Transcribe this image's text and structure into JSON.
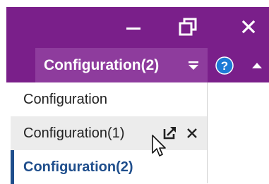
{
  "window_controls": {
    "minimize": "minimize-icon",
    "restore": "restore-icon",
    "close": "close-icon"
  },
  "header": {
    "active_tab_label": "Configuration(2)",
    "dropdown_icon": "dropdown-arrow-icon",
    "help_icon": "help-icon",
    "collapse_icon": "collapse-icon"
  },
  "menu": {
    "items": [
      {
        "label": "Configuration"
      },
      {
        "label": "Configuration(1)",
        "popout_icon": "popout-icon",
        "close_icon": "close-icon"
      },
      {
        "label": "Configuration(2)",
        "selected": true
      }
    ]
  },
  "colors": {
    "titlebar": "#7a1f8a",
    "active_tab": "#8e3c9d",
    "help_icon": "#1d7ad6",
    "selected_text": "#1f4e8c",
    "hover_background": "#ececec"
  }
}
